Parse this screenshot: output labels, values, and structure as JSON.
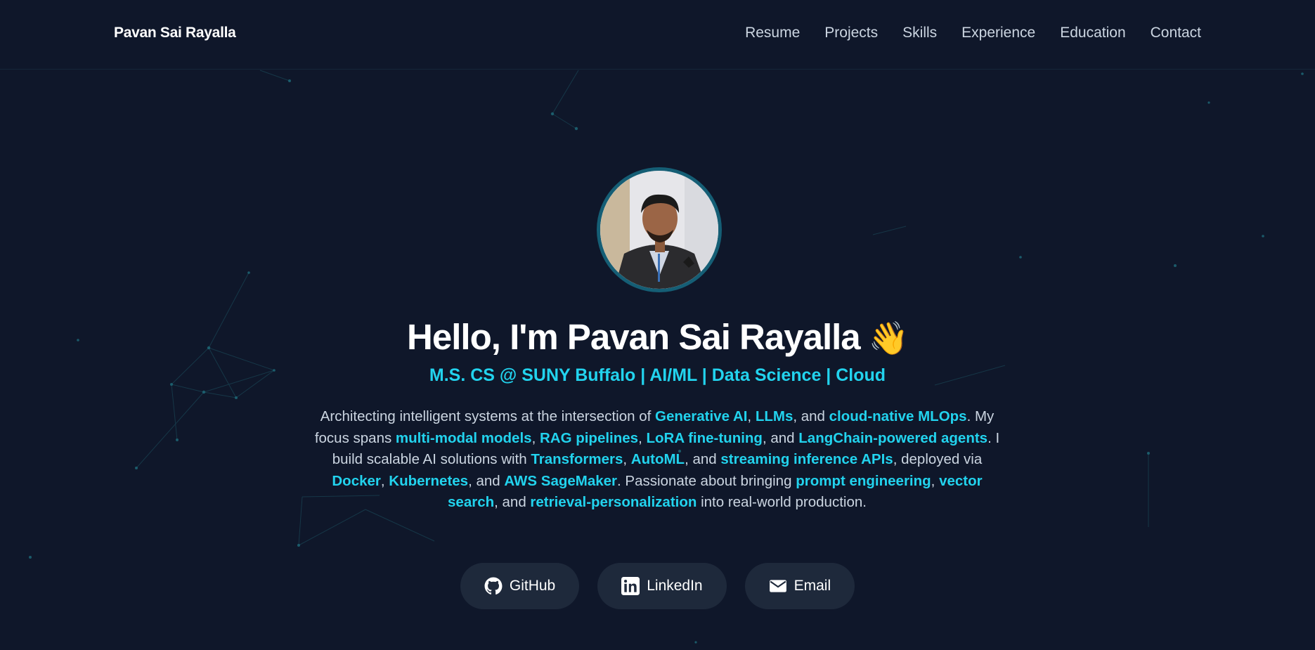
{
  "brand": "Pavan Sai Rayalla",
  "nav": {
    "items": [
      "Resume",
      "Projects",
      "Skills",
      "Experience",
      "Education",
      "Contact"
    ]
  },
  "hero": {
    "greeting": "Hello, I'm Pavan Sai Rayalla",
    "wave": "👋",
    "subtitle": "M.S. CS @ SUNY Buffalo | AI/ML | Data Science | Cloud",
    "bio": [
      {
        "t": "Architecting intelligent systems at the intersection of "
      },
      {
        "t": "Generative AI",
        "hl": true
      },
      {
        "t": ", "
      },
      {
        "t": "LLMs",
        "hl": true
      },
      {
        "t": ", and "
      },
      {
        "t": "cloud-native MLOps",
        "hl": true
      },
      {
        "t": ". My focus spans "
      },
      {
        "t": "multi-modal models",
        "hl": true
      },
      {
        "t": ", "
      },
      {
        "t": "RAG pipelines",
        "hl": true
      },
      {
        "t": ", "
      },
      {
        "t": "LoRA fine-tuning",
        "hl": true
      },
      {
        "t": ", and "
      },
      {
        "t": "LangChain-powered agents",
        "hl": true
      },
      {
        "t": ". I build scalable AI solutions with "
      },
      {
        "t": "Transformers",
        "hl": true
      },
      {
        "t": ", "
      },
      {
        "t": "AutoML",
        "hl": true
      },
      {
        "t": ", and "
      },
      {
        "t": "streaming inference APIs",
        "hl": true
      },
      {
        "t": ", deployed via "
      },
      {
        "t": "Docker",
        "hl": true
      },
      {
        "t": ", "
      },
      {
        "t": "Kubernetes",
        "hl": true
      },
      {
        "t": ", and "
      },
      {
        "t": "AWS SageMaker",
        "hl": true
      },
      {
        "t": ". Passionate about bringing "
      },
      {
        "t": "prompt engineering",
        "hl": true
      },
      {
        "t": ", "
      },
      {
        "t": "vector search",
        "hl": true
      },
      {
        "t": ", and "
      },
      {
        "t": "retrieval-personalization",
        "hl": true
      },
      {
        "t": " into real-world production."
      }
    ]
  },
  "social": {
    "github_label": "GitHub",
    "linkedin_label": "LinkedIn",
    "email_label": "Email",
    "icons": [
      "github-icon",
      "linkedin-icon",
      "mail-icon"
    ]
  },
  "colors": {
    "background": "#0f172a",
    "accent": "#22d3ee",
    "button_bg": "#1e293b",
    "avatar_ring": "#155e75"
  }
}
